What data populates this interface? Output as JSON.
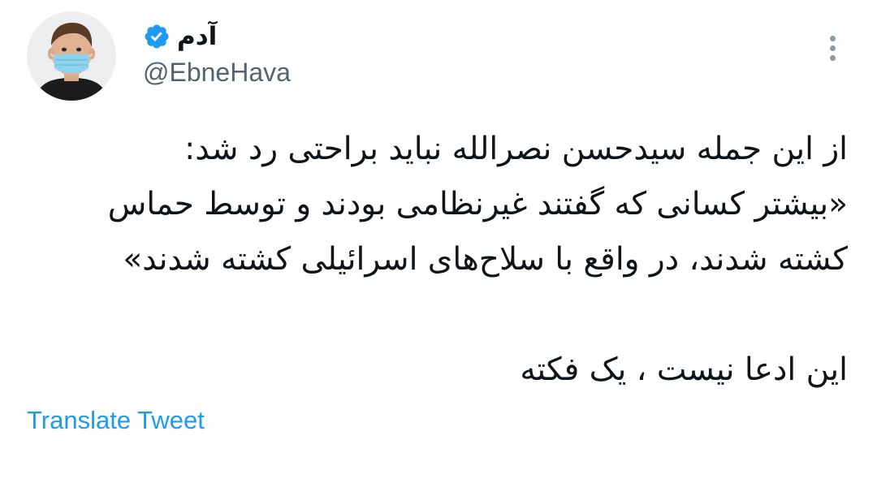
{
  "user": {
    "display_name": "آدم",
    "handle": "@EbneHava",
    "verified_icon": "verified-badge-icon",
    "avatar_icon": "profile-avatar-child-mask"
  },
  "tweet": {
    "lines": [
      "از این جمله سیدحسن نصرالله نباید براحتی رد شد:",
      "«بیشتر کسانی که گفتند غیرنظامی بودند و توسط حماس",
      "کشته شدند، در واقع با سلاح‌های اسرائیلی کشته شدند»",
      "",
      "این ادعا نیست ، یک فکته"
    ],
    "translate_label": "Translate Tweet"
  },
  "menu": {
    "more_icon": "more-vertical-icon"
  },
  "colors": {
    "accent": "#1d9bf0",
    "text": "#0f1419",
    "secondary_text": "#536471",
    "icon_gray": "#8b98a5"
  }
}
